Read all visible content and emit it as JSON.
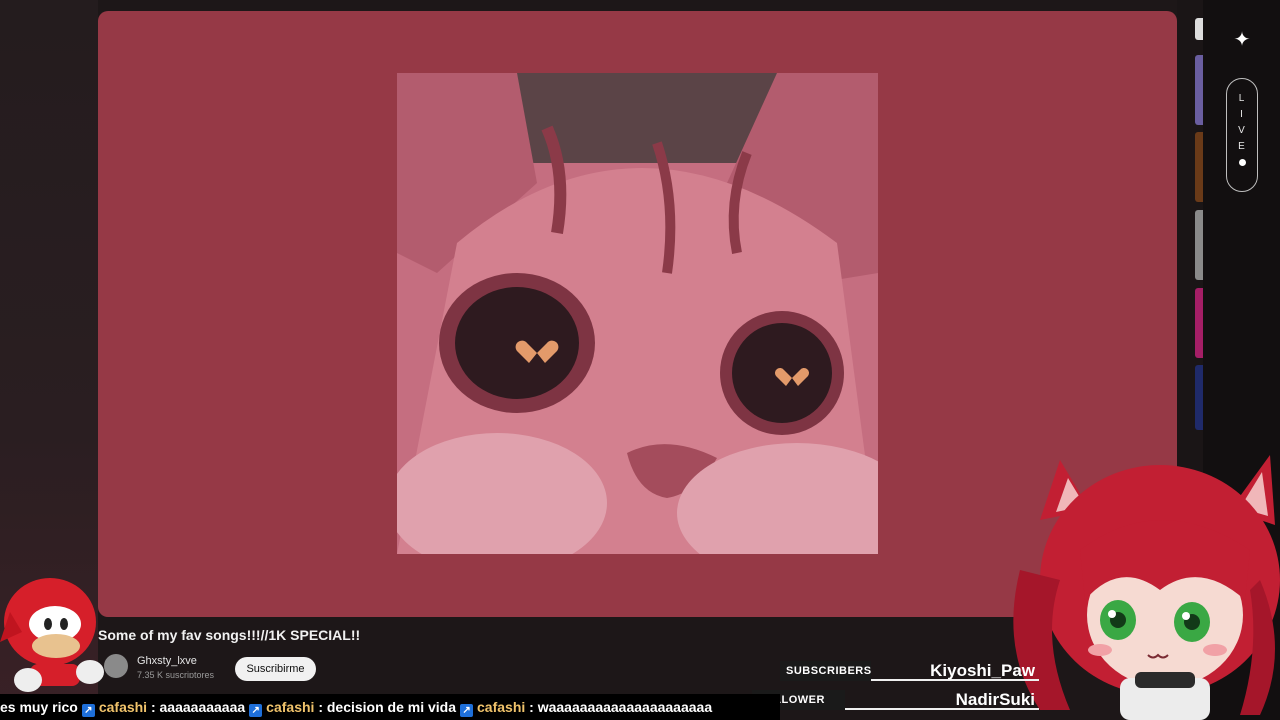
{
  "colors": {
    "panel": "#963946",
    "thumbnail": "#c76b7c",
    "ticker_user": "#f0c36b"
  },
  "side_panel": {
    "live_letters": [
      "L",
      "I",
      "V",
      "E"
    ],
    "sparkle_icon": "sparkle-icon"
  },
  "video": {
    "title": "Some of my fav songs!!!//1K SPECIAL!!",
    "channel_name": "Ghxsty_lxve",
    "channel_subs": "7,35 K suscriptores",
    "subscribe_label": "Suscribirme"
  },
  "ticker": {
    "lead": "es muy rico",
    "messages": [
      {
        "user": "cafashi",
        "text": ": aaaaaaaaaaa"
      },
      {
        "user": "cafashi",
        "text": ": decision de mi vida"
      },
      {
        "user": "cafashi",
        "text": ": waaaaaaaaaaaaaaaaaaaaa"
      }
    ]
  },
  "stats": {
    "subscribers_label": "SUBSCRIBERS",
    "subscribers_value": "Kiyoshi_Paw",
    "follower_label": "FOLLOWER",
    "follower_value": "NadirSuki"
  }
}
